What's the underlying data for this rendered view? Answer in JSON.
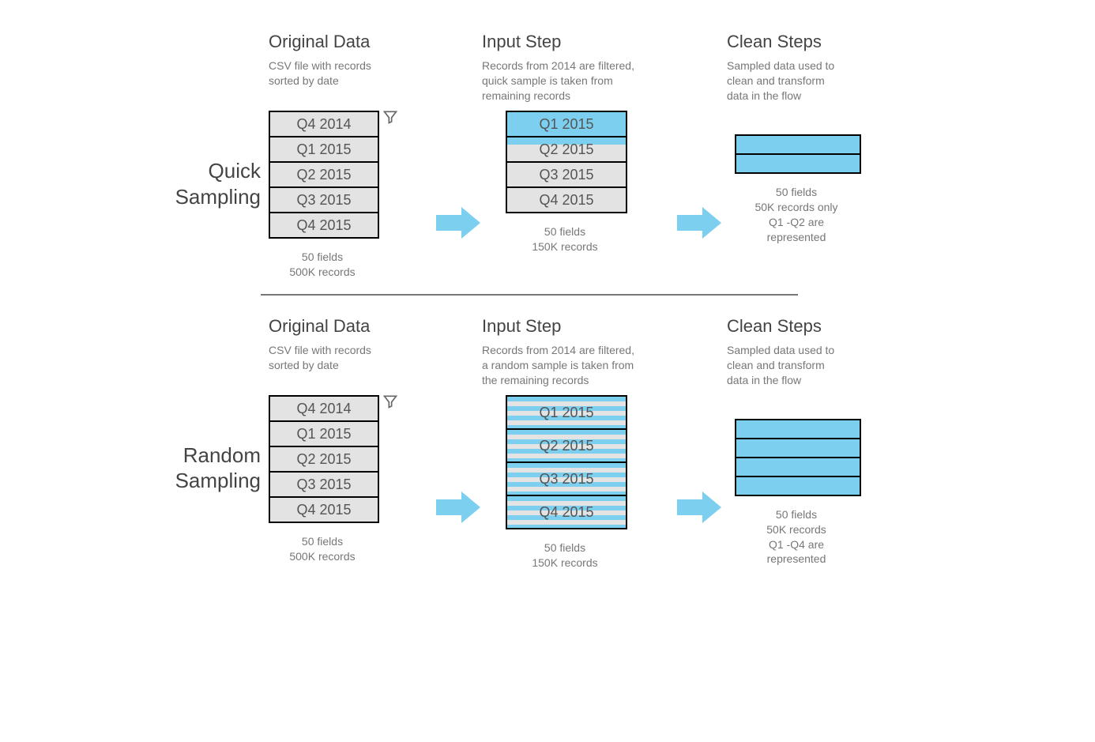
{
  "colors": {
    "blue": "#7ccfee",
    "grey": "#e3e3e3"
  },
  "rows": [
    {
      "label": "Quick\nSampling",
      "original": {
        "title": "Original Data",
        "desc": "CSV file with records\nsorted by date",
        "cells": [
          "Q4 2014",
          "Q1 2015",
          "Q2 2015",
          "Q3 2015",
          "Q4 2015"
        ],
        "caption": "50 fields\n500K records"
      },
      "input": {
        "title": "Input Step",
        "desc": "Records from 2014 are filtered,\nquick sample is taken from\nremaining records",
        "cells": [
          {
            "label": "Q1 2015",
            "style": "lightblue"
          },
          {
            "label": "Q2 2015",
            "style": "halfblue"
          },
          {
            "label": "Q3 2015",
            "style": "grey"
          },
          {
            "label": "Q4 2015",
            "style": "grey"
          }
        ],
        "caption": "50 fields\n150K records"
      },
      "clean": {
        "title": "Clean Steps",
        "desc": "Sampled data used to\nclean and transform\ndata in the flow",
        "resultRows": 2,
        "caption": "50 fields\n50K records only\nQ1 -Q2 are\nrepresented"
      }
    },
    {
      "label": "Random\nSampling",
      "original": {
        "title": "Original Data",
        "desc": "CSV file with records\nsorted by date",
        "cells": [
          "Q4 2014",
          "Q1 2015",
          "Q2 2015",
          "Q3 2015",
          "Q4 2015"
        ],
        "caption": "50 fields\n500K records"
      },
      "input": {
        "title": "Input Step",
        "desc": "Records from 2014 are filtered,\na random sample is taken from\nthe remaining records",
        "cells": [
          {
            "label": "Q1 2015",
            "style": "stripes"
          },
          {
            "label": "Q2 2015",
            "style": "stripes"
          },
          {
            "label": "Q3 2015",
            "style": "stripes"
          },
          {
            "label": "Q4 2015",
            "style": "stripes"
          }
        ],
        "caption": "50 fields\n150K records"
      },
      "clean": {
        "title": "Clean Steps",
        "desc": "Sampled data used to\nclean and transform\ndata in the flow",
        "resultRows": 4,
        "caption": "50 fields\n50K records\nQ1 -Q4 are\nrepresented"
      }
    }
  ]
}
